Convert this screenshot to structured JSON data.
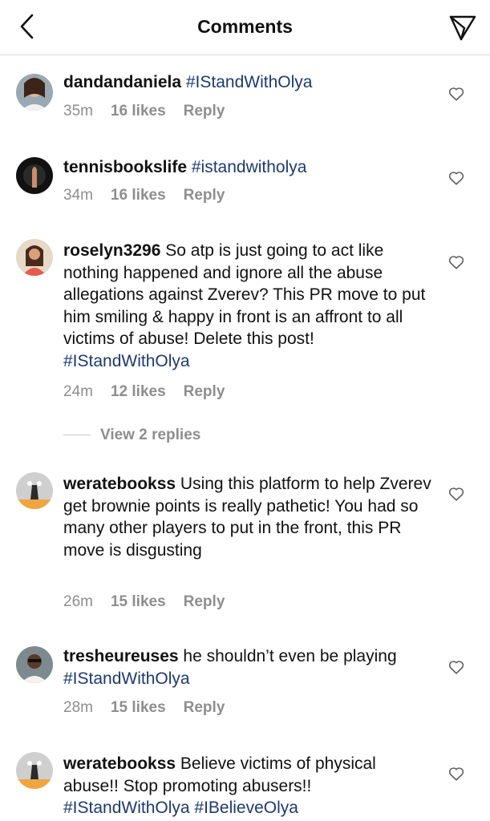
{
  "header": {
    "title": "Comments",
    "back_icon": "chevron-left-icon",
    "send_icon": "send-icon"
  },
  "view_replies": "View 2 replies",
  "reply_label": "Reply",
  "comments": [
    {
      "username": "dandandaniela",
      "text": "",
      "hashtags": "#IStandWithOlya",
      "time": "35m",
      "likes": "16 likes"
    },
    {
      "username": "tennisbookslife",
      "text": "",
      "hashtags": "#istandwitholya",
      "time": "34m",
      "likes": "16 likes"
    },
    {
      "username": "roselyn3296",
      "text": "So atp is just going to act like nothing happened and ignore all the abuse allegations against Zverev? This PR move to put him smiling & happy in front is an affront to all victims of abuse! Delete this post!",
      "hashtags": "#IStandWithOlya",
      "time": "24m",
      "likes": "12 likes"
    },
    {
      "username": "weratebookss",
      "text": "Using this platform to help Zverev get brownie points is really pathetic! You had so many other players to put in the front, this PR move is disgusting",
      "hashtags": "",
      "time": "26m",
      "likes": "15 likes"
    },
    {
      "username": "tresheureuses",
      "text": "he shouldn’t even be playing",
      "hashtags": "#IStandWithOlya",
      "time": "28m",
      "likes": "15 likes"
    },
    {
      "username": "weratebookss",
      "text": "Believe victims of physical abuse!! Stop promoting abusers!!",
      "hashtags": "#IStandWithOlya #IBelieveOlya",
      "time": "",
      "likes": ""
    }
  ]
}
